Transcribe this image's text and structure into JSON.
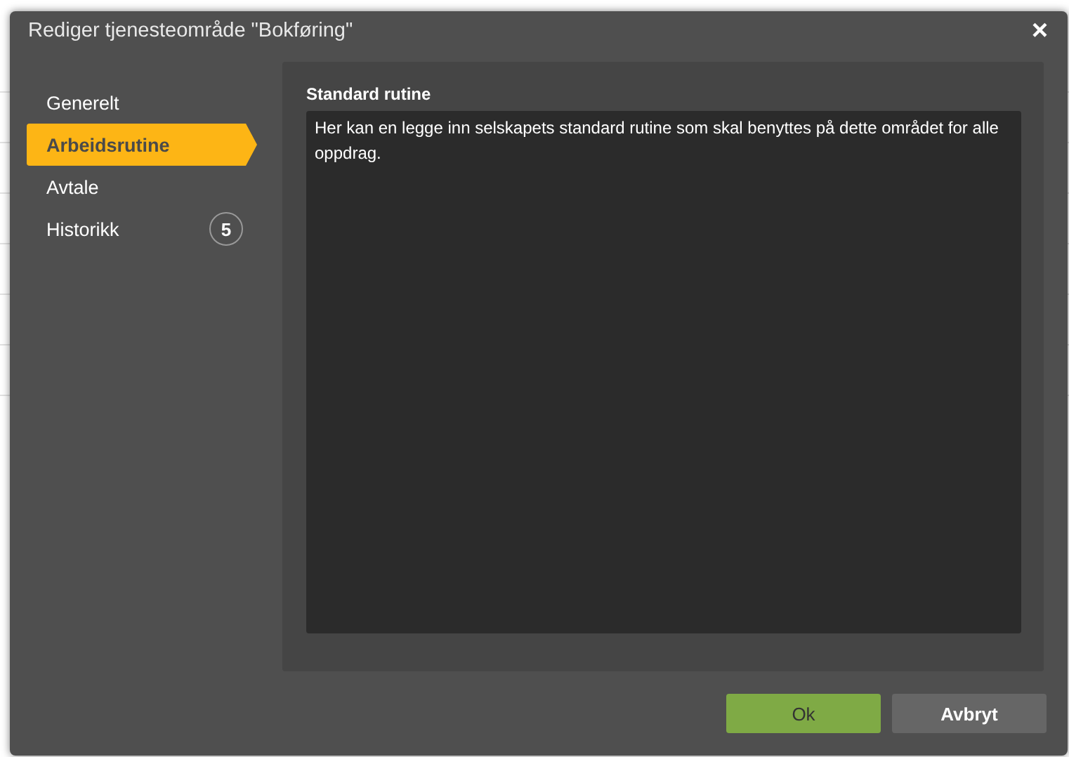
{
  "dialog": {
    "title": "Rediger tjenesteområde \"Bokføring\"",
    "close": "×"
  },
  "sidebar": {
    "items": [
      {
        "label": "Generelt",
        "selected": false
      },
      {
        "label": "Arbeidsrutine",
        "selected": true
      },
      {
        "label": "Avtale",
        "selected": false
      },
      {
        "label": "Historikk",
        "selected": false,
        "badge": "5"
      }
    ]
  },
  "content": {
    "label": "Standard rutine",
    "value": "Her kan en legge inn selskapets standard rutine som skal benyttes på dette området for alle oppdrag."
  },
  "buttons": [
    {
      "label": "Ok",
      "kind": "primary"
    },
    {
      "label": "Avbryt",
      "kind": "secondary"
    }
  ]
}
